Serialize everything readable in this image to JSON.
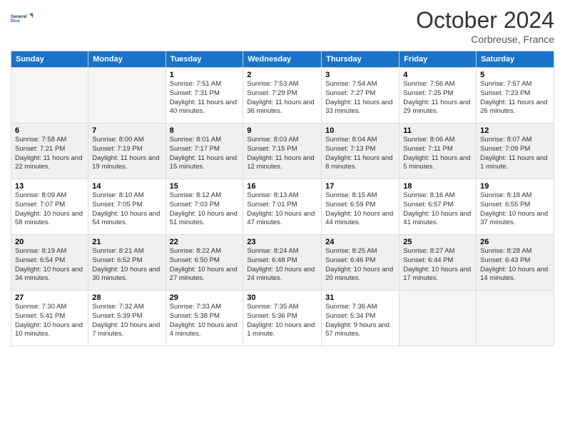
{
  "logo": {
    "line1": "General",
    "line2": "Blue"
  },
  "header": {
    "month": "October 2024",
    "location": "Corbreuse, France"
  },
  "weekdays": [
    "Sunday",
    "Monday",
    "Tuesday",
    "Wednesday",
    "Thursday",
    "Friday",
    "Saturday"
  ],
  "weeks": [
    [
      {
        "day": "",
        "sunrise": "",
        "sunset": "",
        "daylight": ""
      },
      {
        "day": "",
        "sunrise": "",
        "sunset": "",
        "daylight": ""
      },
      {
        "day": "1",
        "sunrise": "Sunrise: 7:51 AM",
        "sunset": "Sunset: 7:31 PM",
        "daylight": "Daylight: 11 hours and 40 minutes."
      },
      {
        "day": "2",
        "sunrise": "Sunrise: 7:53 AM",
        "sunset": "Sunset: 7:29 PM",
        "daylight": "Daylight: 11 hours and 36 minutes."
      },
      {
        "day": "3",
        "sunrise": "Sunrise: 7:54 AM",
        "sunset": "Sunset: 7:27 PM",
        "daylight": "Daylight: 11 hours and 33 minutes."
      },
      {
        "day": "4",
        "sunrise": "Sunrise: 7:56 AM",
        "sunset": "Sunset: 7:25 PM",
        "daylight": "Daylight: 11 hours and 29 minutes."
      },
      {
        "day": "5",
        "sunrise": "Sunrise: 7:57 AM",
        "sunset": "Sunset: 7:23 PM",
        "daylight": "Daylight: 11 hours and 26 minutes."
      }
    ],
    [
      {
        "day": "6",
        "sunrise": "Sunrise: 7:58 AM",
        "sunset": "Sunset: 7:21 PM",
        "daylight": "Daylight: 11 hours and 22 minutes."
      },
      {
        "day": "7",
        "sunrise": "Sunrise: 8:00 AM",
        "sunset": "Sunset: 7:19 PM",
        "daylight": "Daylight: 11 hours and 19 minutes."
      },
      {
        "day": "8",
        "sunrise": "Sunrise: 8:01 AM",
        "sunset": "Sunset: 7:17 PM",
        "daylight": "Daylight: 11 hours and 15 minutes."
      },
      {
        "day": "9",
        "sunrise": "Sunrise: 8:03 AM",
        "sunset": "Sunset: 7:15 PM",
        "daylight": "Daylight: 11 hours and 12 minutes."
      },
      {
        "day": "10",
        "sunrise": "Sunrise: 8:04 AM",
        "sunset": "Sunset: 7:13 PM",
        "daylight": "Daylight: 11 hours and 8 minutes."
      },
      {
        "day": "11",
        "sunrise": "Sunrise: 8:06 AM",
        "sunset": "Sunset: 7:11 PM",
        "daylight": "Daylight: 11 hours and 5 minutes."
      },
      {
        "day": "12",
        "sunrise": "Sunrise: 8:07 AM",
        "sunset": "Sunset: 7:09 PM",
        "daylight": "Daylight: 11 hours and 1 minute."
      }
    ],
    [
      {
        "day": "13",
        "sunrise": "Sunrise: 8:09 AM",
        "sunset": "Sunset: 7:07 PM",
        "daylight": "Daylight: 10 hours and 58 minutes."
      },
      {
        "day": "14",
        "sunrise": "Sunrise: 8:10 AM",
        "sunset": "Sunset: 7:05 PM",
        "daylight": "Daylight: 10 hours and 54 minutes."
      },
      {
        "day": "15",
        "sunrise": "Sunrise: 8:12 AM",
        "sunset": "Sunset: 7:03 PM",
        "daylight": "Daylight: 10 hours and 51 minutes."
      },
      {
        "day": "16",
        "sunrise": "Sunrise: 8:13 AM",
        "sunset": "Sunset: 7:01 PM",
        "daylight": "Daylight: 10 hours and 47 minutes."
      },
      {
        "day": "17",
        "sunrise": "Sunrise: 8:15 AM",
        "sunset": "Sunset: 6:59 PM",
        "daylight": "Daylight: 10 hours and 44 minutes."
      },
      {
        "day": "18",
        "sunrise": "Sunrise: 8:16 AM",
        "sunset": "Sunset: 6:57 PM",
        "daylight": "Daylight: 10 hours and 41 minutes."
      },
      {
        "day": "19",
        "sunrise": "Sunrise: 8:18 AM",
        "sunset": "Sunset: 6:55 PM",
        "daylight": "Daylight: 10 hours and 37 minutes."
      }
    ],
    [
      {
        "day": "20",
        "sunrise": "Sunrise: 8:19 AM",
        "sunset": "Sunset: 6:54 PM",
        "daylight": "Daylight: 10 hours and 34 minutes."
      },
      {
        "day": "21",
        "sunrise": "Sunrise: 8:21 AM",
        "sunset": "Sunset: 6:52 PM",
        "daylight": "Daylight: 10 hours and 30 minutes."
      },
      {
        "day": "22",
        "sunrise": "Sunrise: 8:22 AM",
        "sunset": "Sunset: 6:50 PM",
        "daylight": "Daylight: 10 hours and 27 minutes."
      },
      {
        "day": "23",
        "sunrise": "Sunrise: 8:24 AM",
        "sunset": "Sunset: 6:48 PM",
        "daylight": "Daylight: 10 hours and 24 minutes."
      },
      {
        "day": "24",
        "sunrise": "Sunrise: 8:25 AM",
        "sunset": "Sunset: 6:46 PM",
        "daylight": "Daylight: 10 hours and 20 minutes."
      },
      {
        "day": "25",
        "sunrise": "Sunrise: 8:27 AM",
        "sunset": "Sunset: 6:44 PM",
        "daylight": "Daylight: 10 hours and 17 minutes."
      },
      {
        "day": "26",
        "sunrise": "Sunrise: 8:28 AM",
        "sunset": "Sunset: 6:43 PM",
        "daylight": "Daylight: 10 hours and 14 minutes."
      }
    ],
    [
      {
        "day": "27",
        "sunrise": "Sunrise: 7:30 AM",
        "sunset": "Sunset: 5:41 PM",
        "daylight": "Daylight: 10 hours and 10 minutes."
      },
      {
        "day": "28",
        "sunrise": "Sunrise: 7:32 AM",
        "sunset": "Sunset: 5:39 PM",
        "daylight": "Daylight: 10 hours and 7 minutes."
      },
      {
        "day": "29",
        "sunrise": "Sunrise: 7:33 AM",
        "sunset": "Sunset: 5:38 PM",
        "daylight": "Daylight: 10 hours and 4 minutes."
      },
      {
        "day": "30",
        "sunrise": "Sunrise: 7:35 AM",
        "sunset": "Sunset: 5:36 PM",
        "daylight": "Daylight: 10 hours and 1 minute."
      },
      {
        "day": "31",
        "sunrise": "Sunrise: 7:36 AM",
        "sunset": "Sunset: 5:34 PM",
        "daylight": "Daylight: 9 hours and 57 minutes."
      },
      {
        "day": "",
        "sunrise": "",
        "sunset": "",
        "daylight": ""
      },
      {
        "day": "",
        "sunrise": "",
        "sunset": "",
        "daylight": ""
      }
    ]
  ]
}
